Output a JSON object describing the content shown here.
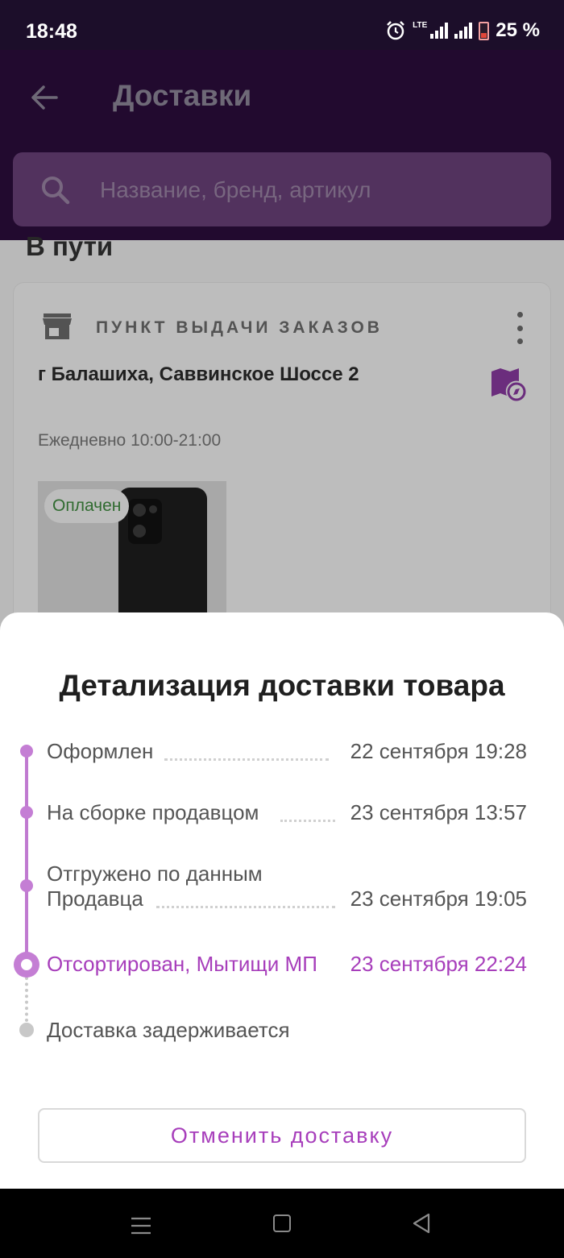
{
  "status_bar": {
    "time": "18:48",
    "network": "LTE",
    "battery": "25 %"
  },
  "app_bar": {
    "title": "Доставки"
  },
  "search": {
    "placeholder": "Название, бренд, артикул"
  },
  "section": {
    "title": "В пути"
  },
  "card": {
    "type_label": "ПУНКТ ВЫДАЧИ ЗАКАЗОВ",
    "address": "г Балашиха, Саввинское Шоссе 2",
    "hours": "Ежедневно 10:00-21:00",
    "badge": "Оплачен"
  },
  "sheet": {
    "title": "Детализация доставки товара",
    "steps": [
      {
        "name": "Оформлен",
        "date": "22 сентября 19:28",
        "state": "done"
      },
      {
        "name": "На сборке продавцом",
        "date": "23 сентября 13:57",
        "state": "done"
      },
      {
        "name_line1": "Отгружено по данным",
        "name_line2": "Продавца",
        "date": "23 сентября 19:05",
        "state": "done"
      },
      {
        "name": "Отсортирован, Мытищи МП",
        "date": "23 сентября 22:24",
        "state": "current"
      },
      {
        "name": "Доставка задерживается",
        "date": "",
        "state": "pending"
      }
    ],
    "cancel_label": "Отменить доставку"
  },
  "colors": {
    "accent": "#a73ebb",
    "timeline": "#c47ed4",
    "app_bar": "#2c0d3d",
    "paid": "#3e8a3e"
  }
}
